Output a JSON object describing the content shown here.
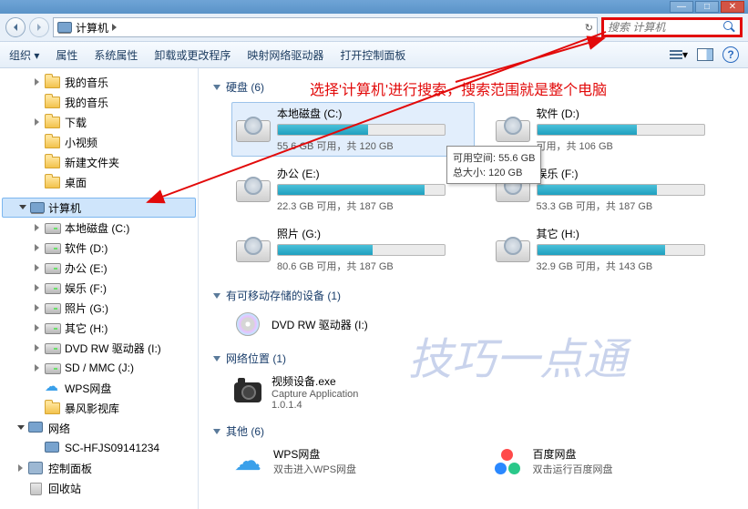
{
  "title_buttons": {
    "min": "—",
    "max": "□",
    "close": "✕"
  },
  "breadcrumb": {
    "root": "计算机",
    "sep": "▶"
  },
  "refresh_glyph": "↻",
  "search": {
    "placeholder": "搜索 计算机"
  },
  "toolbar": {
    "organize": "组织 ▾",
    "properties": "属性",
    "sys_properties": "系统属性",
    "uninstall": "卸载或更改程序",
    "map_drive": "映射网络驱动器",
    "control_panel": "打开控制面板"
  },
  "tree": [
    {
      "label": "我的音乐",
      "icon": "folder",
      "exp": "closed",
      "indent": 1
    },
    {
      "label": "我的音乐",
      "icon": "folder",
      "exp": "none",
      "indent": 1
    },
    {
      "label": "下载",
      "icon": "folder",
      "exp": "closed",
      "indent": 1
    },
    {
      "label": "小视频",
      "icon": "folder",
      "exp": "none",
      "indent": 1
    },
    {
      "label": "新建文件夹",
      "icon": "folder",
      "exp": "none",
      "indent": 1
    },
    {
      "label": "桌面",
      "icon": "folder",
      "exp": "none",
      "indent": 1
    }
  ],
  "computer_label": "计算机",
  "computer_children": [
    {
      "label": "本地磁盘 (C:)",
      "icon": "drive"
    },
    {
      "label": "软件 (D:)",
      "icon": "drive"
    },
    {
      "label": "办公 (E:)",
      "icon": "drive"
    },
    {
      "label": "娱乐 (F:)",
      "icon": "drive"
    },
    {
      "label": "照片 (G:)",
      "icon": "drive"
    },
    {
      "label": "其它 (H:)",
      "icon": "drive"
    },
    {
      "label": "DVD RW 驱动器 (I:)",
      "icon": "drive"
    },
    {
      "label": "SD / MMC (J:)",
      "icon": "drive"
    },
    {
      "label": "WPS网盘",
      "icon": "cloud"
    },
    {
      "label": "暴风影视库",
      "icon": "folder"
    }
  ],
  "network_label": "网络",
  "network_children": [
    {
      "label": "SC-HFJS09141234"
    }
  ],
  "control_panel_label": "控制面板",
  "recycle_label": "回收站",
  "sections": {
    "drives": "硬盘 (6)",
    "removable": "有可移动存储的设备 (1)",
    "network": "网络位置 (1)",
    "other": "其他 (6)"
  },
  "drives": [
    {
      "name": "本地磁盘 (C:)",
      "stat": "55.6 GB 可用，共 120 GB",
      "pct": 54,
      "sel": true
    },
    {
      "name": "软件 (D:)",
      "stat": "可用，共 106 GB",
      "pct": 60
    },
    {
      "name": "办公 (E:)",
      "stat": "22.3 GB 可用，共 187 GB",
      "pct": 88
    },
    {
      "name": "娱乐 (F:)",
      "stat": "53.3 GB 可用，共 187 GB",
      "pct": 72
    },
    {
      "name": "照片 (G:)",
      "stat": "80.6 GB 可用，共 187 GB",
      "pct": 57
    },
    {
      "name": "其它 (H:)",
      "stat": "32.9 GB 可用，共 143 GB",
      "pct": 77
    }
  ],
  "dvd_name": "DVD RW 驱动器 (I:)",
  "netloc": {
    "name": "视频设备.exe",
    "sub1": "Capture Application",
    "sub2": "1.0.1.4"
  },
  "other": {
    "wps_title": "WPS网盘",
    "wps_sub": "双击进入WPS网盘",
    "baidu_title": "百度网盘",
    "baidu_sub": "双击运行百度网盘"
  },
  "tooltip": {
    "line1": "可用空间: 55.6 GB",
    "line2": "总大小: 120 GB"
  },
  "annotation": "选择'计算机'进行搜索，搜索范围就是整个电脑",
  "watermark": "技巧一点通"
}
